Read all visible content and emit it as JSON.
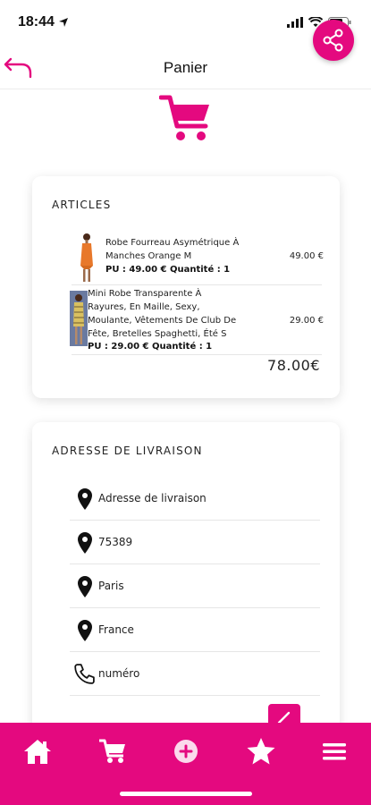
{
  "status_bar": {
    "time": "18:44"
  },
  "nav": {
    "title": "Panier"
  },
  "articles": {
    "title": "ARTICLES",
    "items": [
      {
        "name": "Robe Fourreau Asymétrique À\nManches Orange M",
        "pu": "PU : 49.00 € Quantité : 1",
        "price": "49.00 €"
      },
      {
        "name": "Mini Robe Transparente À\nRayures, En Maille, Sexy,\nMoulante, Vêtements De Club De\nFête, Bretelles Spaghetti, Été S",
        "pu": "PU : 29.00 € Quantité : 1",
        "price": "29.00 €"
      }
    ],
    "total": "78.00€"
  },
  "address": {
    "title": "ADRESSE DE LIVRAISON",
    "rows": [
      {
        "icon": "location-pin-icon",
        "label": "Adresse de livraison"
      },
      {
        "icon": "location-pin-icon",
        "label": "75389"
      },
      {
        "icon": "location-pin-icon",
        "label": "Paris"
      },
      {
        "icon": "location-pin-icon",
        "label": "France"
      },
      {
        "icon": "phone-icon",
        "label": "numéro"
      }
    ]
  },
  "tabs": [
    "home-icon",
    "cart-icon",
    "plus-circle-icon",
    "star-icon",
    "menu-icon"
  ],
  "colors": {
    "accent": "#e4097f",
    "text": "#222222",
    "background": "#ffffff"
  }
}
